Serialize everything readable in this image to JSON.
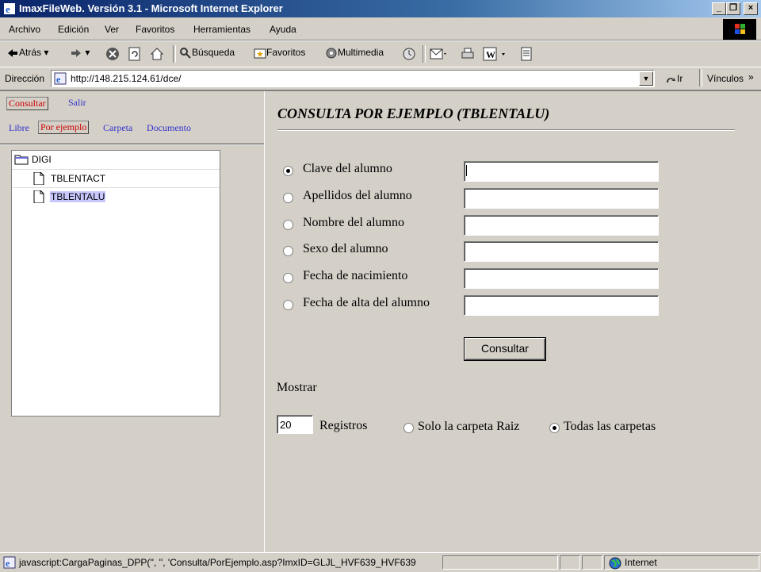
{
  "window": {
    "title": "ImaxFileWeb. Versión 3.1 - Microsoft Internet Explorer"
  },
  "menu": [
    "Archivo",
    "Edición",
    "Ver",
    "Favoritos",
    "Herramientas",
    "Ayuda"
  ],
  "toolbar": {
    "back": "Atrás",
    "search": "Búsqueda",
    "favorites": "Favoritos",
    "multimedia": "Multimedia"
  },
  "address": {
    "label": "Dirección",
    "url": "http://148.215.124.61/dce/",
    "go": "Ir",
    "links": "Vínculos"
  },
  "left_nav": {
    "top_links": [
      "Consultar",
      "Salir"
    ],
    "mode_links": [
      "Libre",
      "Por ejemplo",
      "Carpeta",
      "Documento"
    ]
  },
  "tree": {
    "root": "DIGI",
    "items": [
      "TBLENTACT",
      "TBLENTALU"
    ],
    "selected": "TBLENTALU"
  },
  "form": {
    "title": "CONSULTA POR EJEMPLO (TBLENTALU)",
    "fields": [
      {
        "label": "Clave del alumno",
        "value": "",
        "checked": true
      },
      {
        "label": "Apellidos del alumno",
        "value": "",
        "checked": false
      },
      {
        "label": "Nombre del alumno",
        "value": "",
        "checked": false
      },
      {
        "label": "Sexo del alumno",
        "value": "",
        "checked": false
      },
      {
        "label": "Fecha de nacimiento",
        "value": "",
        "checked": false
      },
      {
        "label": "Fecha de alta del alumno",
        "value": "",
        "checked": false
      }
    ],
    "submit": "Consultar",
    "show_label": "Mostrar",
    "records_value": "20",
    "records_label": "Registros",
    "scope_options": [
      {
        "label": "Solo la carpeta Raiz",
        "checked": false
      },
      {
        "label": "Todas las carpetas",
        "checked": true
      }
    ]
  },
  "status": {
    "text": "javascript:CargaPaginas_DPP('', '', 'Consulta/PorEjemplo.asp?ImxID=GLJL_HVF639_HVF639",
    "zone": "Internet"
  }
}
